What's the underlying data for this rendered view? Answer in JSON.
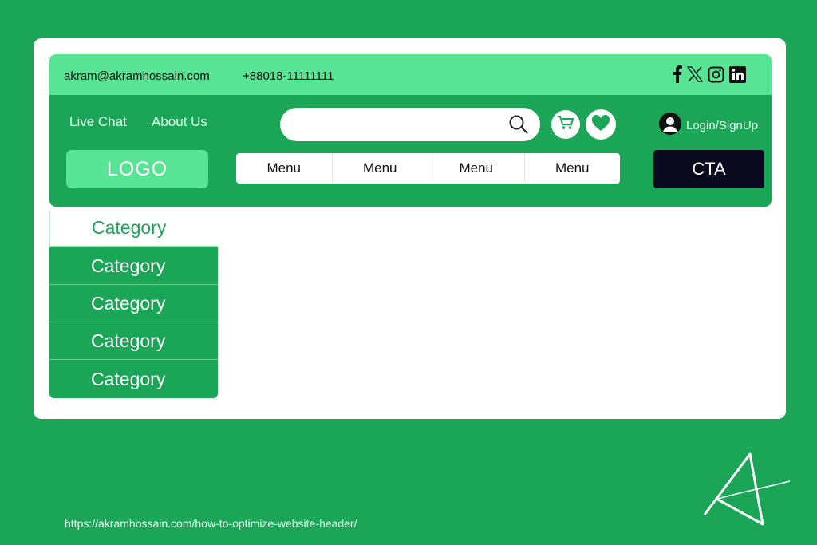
{
  "topbar": {
    "email": "akram@akramhossain.com",
    "phone": "+88018-11111111",
    "social": [
      "facebook-icon",
      "x-icon",
      "instagram-icon",
      "linkedin-icon"
    ]
  },
  "nav": {
    "links": [
      "Live Chat",
      "About Us"
    ],
    "search": {
      "value": "",
      "placeholder": ""
    },
    "login_label": "Login/SignUp",
    "logo_label": "LOGO",
    "menu": [
      "Menu",
      "Menu",
      "Menu",
      "Menu"
    ],
    "cta_label": "CTA"
  },
  "categories": [
    "Category",
    "Category",
    "Category",
    "Category",
    "Category"
  ],
  "footer": {
    "url": "https://akramhossain.com/how-to-optimize-website-header/"
  },
  "colors": {
    "background": "#1ba557",
    "accent_light": "#57e494",
    "cta": "#0a0a1f"
  }
}
